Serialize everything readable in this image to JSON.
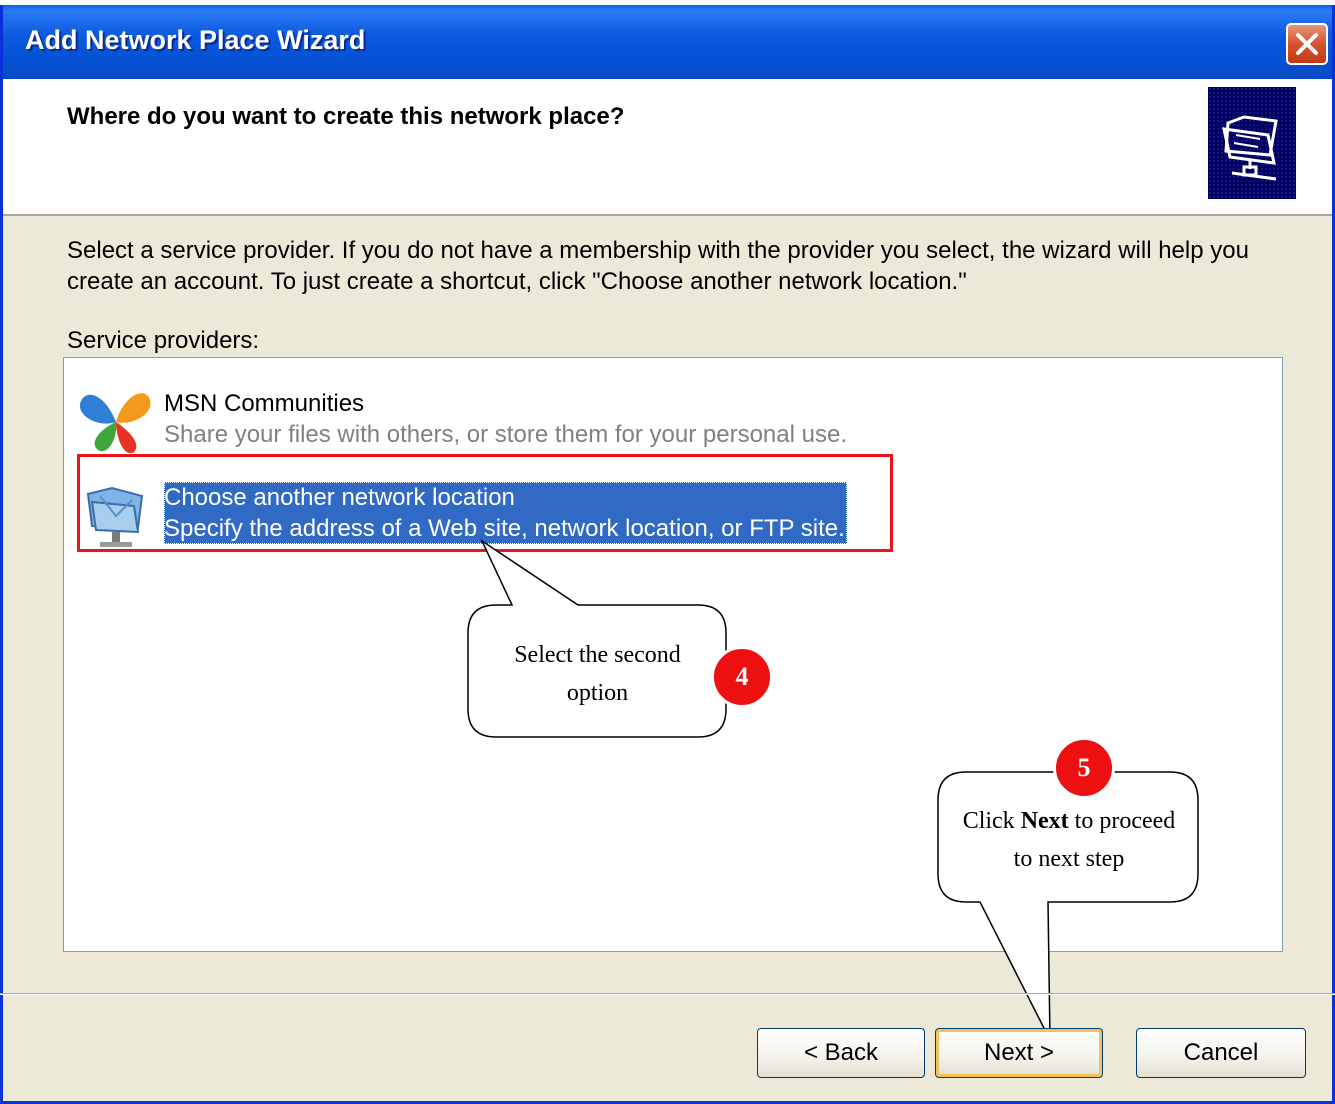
{
  "window": {
    "title": "Add Network Place Wizard"
  },
  "header": {
    "title": "Where do you want to create this network place?",
    "icon": "network-folder-icon"
  },
  "description": "Select a service provider.  If you do not have a membership with the provider you select, the wizard will help you create an account.  To just create a shortcut, click \"Choose another network location.\"",
  "providers": {
    "label": "Service providers:",
    "items": [
      {
        "name": "MSN Communities",
        "description": "Share your files with others, or store them for your personal use.",
        "icon": "msn-butterfly-icon",
        "selected": false
      },
      {
        "name": "Choose another network location",
        "description": "Specify the address of a Web site, network location, or FTP site.",
        "icon": "network-location-icon",
        "selected": true
      }
    ]
  },
  "annotations": {
    "step4": {
      "badge": "4",
      "text_line1": "Select the second",
      "text_line2": "option"
    },
    "step5": {
      "badge": "5",
      "text_pre": "Click ",
      "text_bold": "Next",
      "text_post": " to proceed",
      "text_line2": "to next step"
    }
  },
  "buttons": {
    "back": "< Back",
    "next": "Next >",
    "cancel": "Cancel"
  },
  "colors": {
    "titlebar": "#0452d6",
    "selection": "#316ac5",
    "highlight_border": "#e8141c",
    "badge": "#ee1010",
    "dialog_bg": "#ece9d8"
  }
}
